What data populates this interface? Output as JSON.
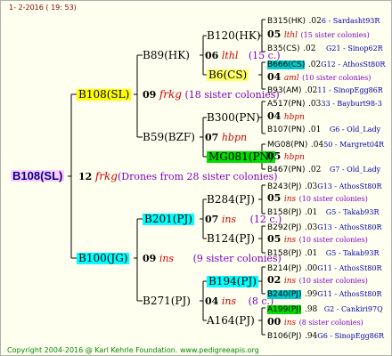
{
  "date": "1- 2-2016 ( 19: 53)",
  "copyright": "Copyright 2004-2016 @ Karl Kehrle Foundation.   www.pedigreeapis.org",
  "root": {
    "name": "B108(SL)",
    "year": "12",
    "kind": "frkg",
    "note": "(Drones from 28 sister colonies)"
  },
  "g1": {
    "top": {
      "name": "B108(SL)",
      "year": "09",
      "kind": "frkg",
      "note": "(18 sister colonies)"
    },
    "bottom": {
      "name": "B100(JG)",
      "year": "09",
      "kind": "ins",
      "note": "(9 sister colonies)"
    }
  },
  "g2": {
    "a": {
      "name": "B89(HK)",
      "year": "06",
      "kind": "lthl",
      "note": "(15 c.)"
    },
    "b": {
      "name": "B59(BZF)",
      "year": "07",
      "kind": "hbpn"
    },
    "c": {
      "name": "B201(PJ)",
      "year": "07",
      "kind": "ins",
      "note": "(12 c.)"
    },
    "d": {
      "name": "B271(PJ)",
      "year": "04",
      "kind": "ins",
      "note": "(8 c.)"
    }
  },
  "g3": [
    "B120(HK)",
    "B6(CS)",
    "B300(PN)",
    "MG081(PN)",
    "B284(PJ)",
    "B124(PJ)",
    "B194(PJ)",
    "A164(PJ)"
  ],
  "g4": [
    {
      "name": "B315(HK)",
      "rest": ".02",
      "tail": "6 - Sardasht93R"
    },
    {
      "year": "05",
      "kind": "lthl",
      "note": "(15 sister colonies)"
    },
    {
      "name": "B35(CS)",
      "rest": ".02",
      "tail": "G21 - Sinop62R"
    },
    {
      "name": "B666(CS)",
      "rest": ".02",
      "tail": "G12 - AthosSt80R"
    },
    {
      "year": "04",
      "kind": "aml",
      "note": "(10 sister colonies)"
    },
    {
      "name": "B93(AM)",
      "rest": ".02",
      "tail": "11 - SinopEgg86R"
    },
    {
      "name": "A517(PN)",
      "rest": ".03",
      "tail": "33 - Bayburt98-3"
    },
    {
      "year": "04",
      "kind": "hbpn",
      "note": ""
    },
    {
      "name": "B107(PN)",
      "rest": ".01",
      "tail": "G6 - Old_Lady"
    },
    {
      "name": "MG08(PN)",
      "rest": ".04",
      "tail": "50 - Margret04R"
    },
    {
      "year": "05",
      "kind": "hbpn",
      "note": ""
    },
    {
      "name": "B467(PN)",
      "rest": ".02",
      "tail": "G7 - Old_Lady"
    },
    {
      "name": "B243(PJ)",
      "rest": ".03",
      "tail": "G13 - AthosSt80R"
    },
    {
      "year": "05",
      "kind": "ins",
      "note": "(10 sister colonies)"
    },
    {
      "name": "B158(PJ)",
      "rest": ".01",
      "tail": "G5 - Takab93R"
    },
    {
      "name": "B292(PJ)",
      "rest": ".03",
      "tail": "G13 - AthosSt80R"
    },
    {
      "year": "05",
      "kind": "ins",
      "note": "(10 sister colonies)"
    },
    {
      "name": "B158(PJ)",
      "rest": ".01",
      "tail": "G5 - Takab93R"
    },
    {
      "name": "B214(PJ)",
      "rest": ".00",
      "tail": "G11 - AthosSt80R"
    },
    {
      "year": "02",
      "kind": "ins",
      "note": "(10 sister colonies)"
    },
    {
      "name": "B240(PJ)",
      "rest": ".99",
      "tail": "G11 - AthosSt80R"
    },
    {
      "name": "A199(PJ)",
      "rest": ".98",
      "tail": "G2 - Cankiri97Q"
    },
    {
      "year": "00",
      "kind": "ins",
      "note": "(8 sister colonies)"
    },
    {
      "name": "B106(PJ)",
      "rest": ".94",
      "tail": "G6 - SinopEgg86R"
    }
  ],
  "colors": {
    "lines": "#000000",
    "yellow": "#ffff00",
    "cyan": "#00ffff",
    "green": "#00dd00"
  }
}
